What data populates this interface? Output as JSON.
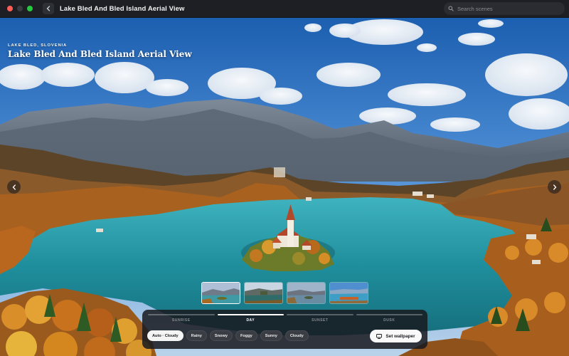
{
  "window": {
    "title": "Lake Bled And Bled Island Aerial View"
  },
  "search": {
    "placeholder": "Search scenes"
  },
  "scene": {
    "location": "LAKE BLED, SLOVENIA",
    "title": "Lake Bled And Bled Island Aerial View"
  },
  "thumbnails": [
    {
      "name": "sunrise",
      "selected": true
    },
    {
      "name": "day",
      "selected": false
    },
    {
      "name": "sunset",
      "selected": false
    },
    {
      "name": "dusk",
      "selected": false
    }
  ],
  "timeline": {
    "segments": [
      "SUNRISE",
      "DAY",
      "SUNSET",
      "DUSK"
    ],
    "active": "DAY"
  },
  "weather": {
    "options": [
      "Auto · Cloudy",
      "Rainy",
      "Snowy",
      "Foggy",
      "Sunny",
      "Cloudy"
    ],
    "selected": "Auto · Cloudy"
  },
  "actions": {
    "set_wallpaper": "Set wallpaper"
  },
  "icons": {
    "back": "chevron-left-icon",
    "search": "search-icon",
    "prev": "chevron-left-icon",
    "next": "chevron-right-icon",
    "wallpaper": "monitor-icon"
  },
  "colors": {
    "close": "#ff5f57",
    "maximize": "#28c840",
    "lake": "#1f8e9c",
    "panel": "#181a20"
  }
}
